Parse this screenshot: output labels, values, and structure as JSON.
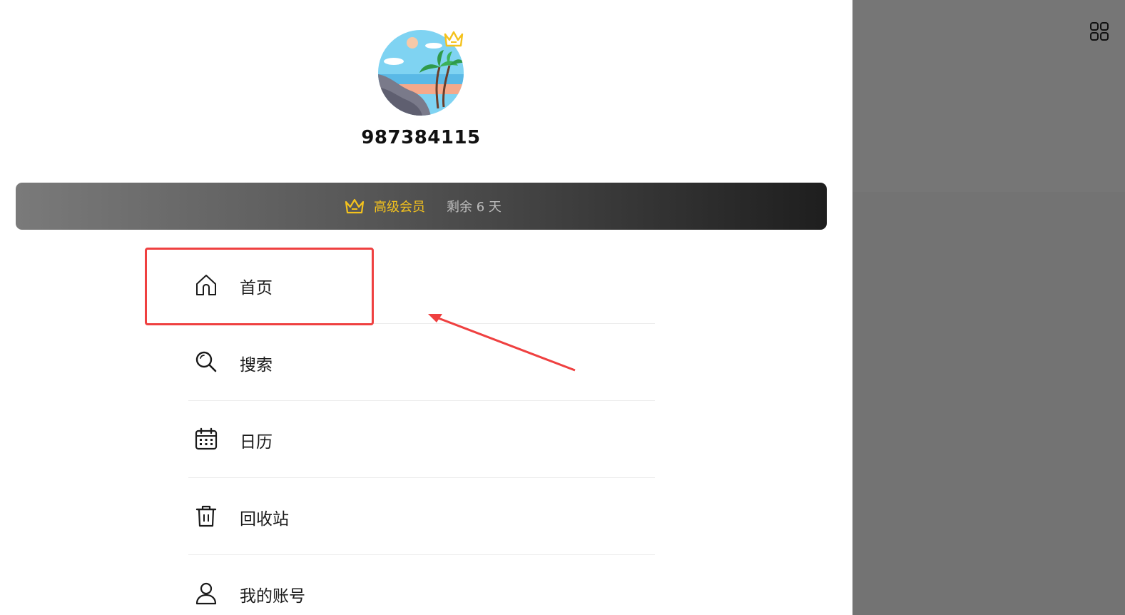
{
  "profile": {
    "username": "987384115",
    "avatar_icon": "beach-palm-avatar"
  },
  "vip": {
    "icon": "crown-icon",
    "title": "高级会员",
    "remaining": "剩余 6 天",
    "accent_color": "#f4c21d"
  },
  "menu": {
    "items": [
      {
        "label": "首页",
        "icon": "home-icon"
      },
      {
        "label": "搜索",
        "icon": "search-icon"
      },
      {
        "label": "日历",
        "icon": "calendar-icon"
      },
      {
        "label": "回收站",
        "icon": "trash-icon"
      },
      {
        "label": "我的账号",
        "icon": "user-icon"
      }
    ]
  },
  "top_right": {
    "icon": "grid-icon"
  },
  "annotation": {
    "highlight_color": "#ef4040"
  }
}
